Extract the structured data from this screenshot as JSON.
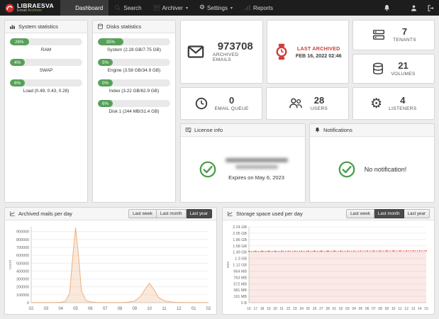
{
  "navbar": {
    "brand_title": "LIBRAESVA",
    "brand_subtitle_plain": "Email ",
    "brand_subtitle_accent": "Archiver",
    "items": [
      {
        "label": "Dashboard",
        "active": true
      },
      {
        "label": "Search",
        "active": false
      },
      {
        "label": "Archiver",
        "active": false
      },
      {
        "label": "Settings",
        "active": false
      },
      {
        "label": "Reports",
        "active": false
      }
    ]
  },
  "system_statistics": {
    "title": "System statistics",
    "bars": [
      {
        "percent": "26%",
        "width": 26,
        "label": "RAM"
      },
      {
        "percent": "4%",
        "width": 4,
        "label": "SWAP"
      },
      {
        "percent": "6%",
        "width": 6,
        "label": "Load (0.49, 0.43, 0.28)"
      }
    ]
  },
  "disks_statistics": {
    "title": "Disks statistics",
    "bars": [
      {
        "percent": "35%",
        "width": 35,
        "label": "System (2.28 GB/7.75 GB)"
      },
      {
        "percent": "5%",
        "width": 5,
        "label": "Engine (3.58 GB/34.9 GB)"
      },
      {
        "percent": "0%",
        "width": 0,
        "label": "Index (3.22 GB/62.9 GB)"
      },
      {
        "percent": "6%",
        "width": 6,
        "label": "Disk 1 (244 MB/31.4 GB)"
      }
    ]
  },
  "stat_cards": {
    "archived_emails": {
      "value": "973708",
      "label": "ARCHIVED EMAILS"
    },
    "last_archived": {
      "line1": "LAST ARCHIVED",
      "line2": "FEB 16, 2022 02:46"
    },
    "tenants": {
      "value": "7",
      "label": "TENANTS"
    },
    "volumes": {
      "value": "21",
      "label": "VOLUMES"
    },
    "email_queue": {
      "value": "0",
      "label": "EMAIL QUEUE"
    },
    "users": {
      "value": "28",
      "label": "USERS"
    },
    "listeners": {
      "value": "4",
      "label": "LISTENERS"
    }
  },
  "license": {
    "title": "License info",
    "expires": "Expires on May 6, 2023"
  },
  "notifications_panel": {
    "title": "Notifications",
    "message": "No notification!"
  },
  "chart_cards": [
    {
      "buttons": [
        {
          "label": "Last week",
          "active": false
        },
        {
          "label": "Last month",
          "active": false
        },
        {
          "label": "Last year",
          "active": true
        }
      ]
    },
    {
      "buttons": [
        {
          "label": "Last week",
          "active": false
        },
        {
          "label": "Last month",
          "active": true
        },
        {
          "label": "Last year",
          "active": false
        }
      ]
    }
  ],
  "chart_data": [
    {
      "type": "area",
      "title": "Archived mails per day",
      "xlabel": "",
      "ylabel": "count",
      "legend": "none",
      "grid": true,
      "ylim": [
        0,
        960000
      ],
      "x_labels": [
        "02",
        "03",
        "04",
        "05",
        "06",
        "07",
        "08",
        "09",
        "10",
        "11",
        "12",
        "01",
        "02"
      ],
      "y_tick_values": [
        0,
        100000,
        200000,
        300000,
        400000,
        500000,
        600000,
        700000,
        800000,
        900000
      ],
      "y_tick_labels": [
        "0",
        "100000",
        "200000",
        "300000",
        "400000",
        "500000",
        "600000",
        "700000",
        "800000",
        "900000"
      ],
      "series": [
        {
          "name": "archived mails",
          "color": "#edaf7c",
          "fill": "rgba(237,175,124,0.28)",
          "dashed": false,
          "dots": false,
          "points": [
            [
              0,
              2000
            ],
            [
              0.5,
              1500
            ],
            [
              1,
              2000
            ],
            [
              1.5,
              2500
            ],
            [
              2,
              5000
            ],
            [
              2.3,
              15000
            ],
            [
              2.6,
              120000
            ],
            [
              2.8,
              550000
            ],
            [
              3,
              950000
            ],
            [
              3.2,
              600000
            ],
            [
              3.4,
              150000
            ],
            [
              3.7,
              30000
            ],
            [
              4,
              10000
            ],
            [
              4.5,
              4000
            ],
            [
              5,
              3000
            ],
            [
              5.5,
              2500
            ],
            [
              6,
              2500
            ],
            [
              6.5,
              5000
            ],
            [
              7,
              20000
            ],
            [
              7.4,
              80000
            ],
            [
              7.7,
              170000
            ],
            [
              8,
              245000
            ],
            [
              8.3,
              170000
            ],
            [
              8.6,
              70000
            ],
            [
              9,
              25000
            ],
            [
              9.5,
              8000
            ],
            [
              10,
              4000
            ],
            [
              10.5,
              2500
            ],
            [
              11,
              2000
            ],
            [
              11.5,
              1500
            ],
            [
              12,
              1000
            ]
          ]
        }
      ]
    },
    {
      "type": "area",
      "title": "Storage space used per day",
      "xlabel": "",
      "ylabel": "size",
      "legend": "none",
      "grid": true,
      "ylim": [
        0,
        2289
      ],
      "unit": "MB",
      "x_labels": [
        "16",
        "17",
        "18",
        "19",
        "20",
        "21",
        "22",
        "23",
        "24",
        "25",
        "26",
        "27",
        "28",
        "01",
        "02",
        "03",
        "04",
        "05",
        "06",
        "07",
        "08",
        "09",
        "10",
        "11",
        "12",
        "13",
        "14",
        "15"
      ],
      "y_tick_values": [
        0,
        190.75,
        381.5,
        572.25,
        763,
        953.75,
        1144.5,
        1335.25,
        1526,
        1716.75,
        1907.5,
        2098.25,
        2289
      ],
      "y_tick_labels": [
        "0 B",
        "191 MB",
        "381 MB",
        "572 MB",
        "763 MB",
        "954 MB",
        "1.12 GB",
        "1.3 GB",
        "1.49 GB",
        "1.68 GB",
        "1.86 GB",
        "2.05 GB",
        "2.24 GB"
      ],
      "series": [
        {
          "name": "storage used",
          "color": "#e05348",
          "fill": "rgba(224,83,72,0.13)",
          "dashed": true,
          "dots": true,
          "values": [
            1552,
            1553,
            1553,
            1554,
            1554,
            1555,
            1555,
            1556,
            1556,
            1557,
            1557,
            1558,
            1558,
            1559,
            1559,
            1560,
            1560,
            1561,
            1561,
            1562,
            1562,
            1563,
            1563,
            1564,
            1565,
            1566,
            1567,
            1568
          ]
        }
      ]
    }
  ]
}
